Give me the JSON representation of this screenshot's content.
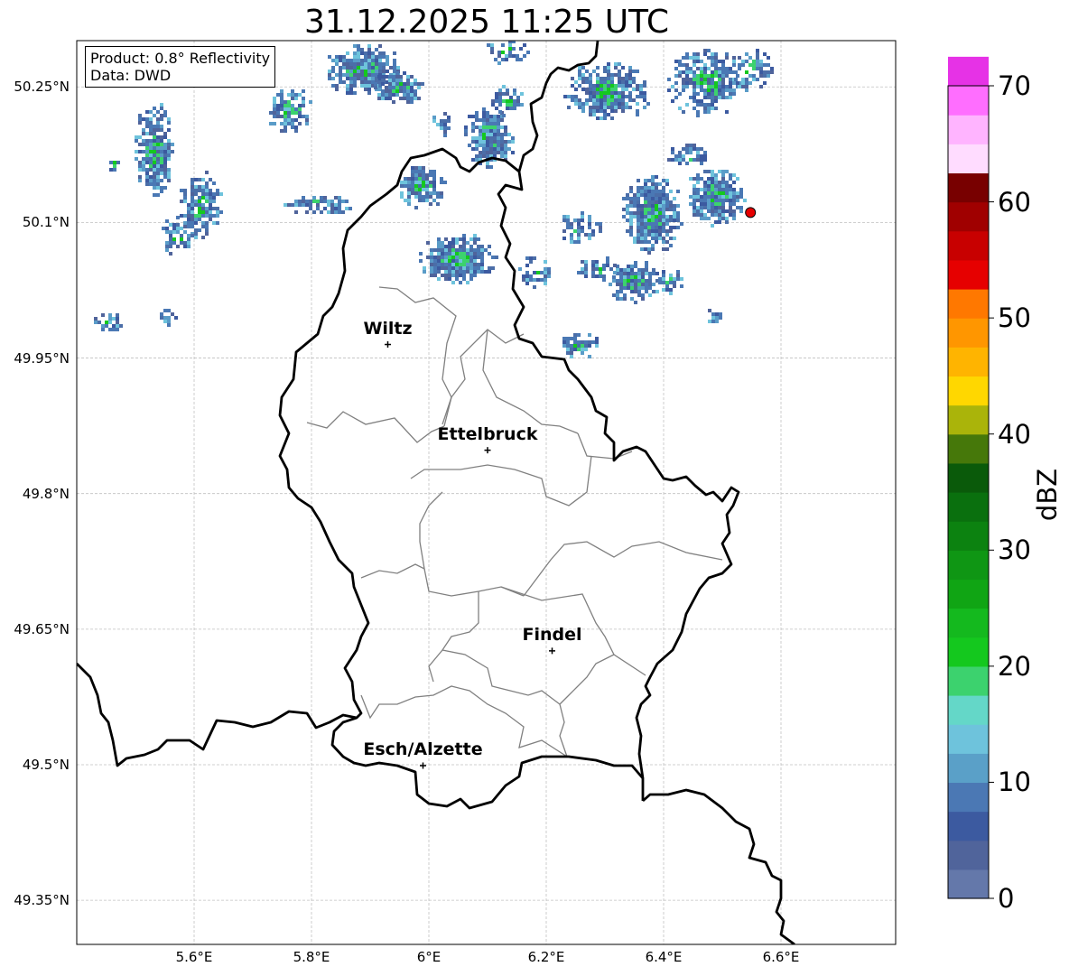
{
  "title": "31.12.2025 11:25 UTC",
  "info": {
    "product": "Product: 0.8° Reflectivity",
    "source": "Data: DWD"
  },
  "lat_labels": [
    "50.25°N",
    "50.1°N",
    "49.95°N",
    "49.8°N",
    "49.65°N",
    "49.5°N",
    "49.35°N"
  ],
  "lon_labels": [
    "5.6°E",
    "5.8°E",
    "6°E",
    "6.2°E",
    "6.4°E",
    "6.6°E"
  ],
  "cities": [
    {
      "name": "Wiltz",
      "lon": 5.93,
      "lat": 49.965
    },
    {
      "name": "Ettelbruck",
      "lon": 6.1,
      "lat": 49.848
    },
    {
      "name": "Findel",
      "lon": 6.21,
      "lat": 49.626
    },
    {
      "name": "Esch/Alzette",
      "lon": 5.99,
      "lat": 49.499
    }
  ],
  "radar_site": {
    "lon": 6.548,
    "lat": 50.111,
    "color": "#e60000"
  },
  "colorbar": {
    "label": "dBZ",
    "ticks": [
      "0",
      "10",
      "20",
      "30",
      "40",
      "50",
      "60",
      "70"
    ],
    "min": 0,
    "max": 70,
    "step": 2.5,
    "colors": [
      "#6478aa",
      "#50649b",
      "#3c5aa0",
      "#4b78b4",
      "#5aa0c8",
      "#6ec3dc",
      "#64d7c8",
      "#3cd26e",
      "#14c81e",
      "#14b91e",
      "#10a514",
      "#0f9614",
      "#0c8210",
      "#0a700e",
      "#0a5a0a",
      "#46780a",
      "#aab40a",
      "#ffd700",
      "#ffb400",
      "#ff9600",
      "#ff7800",
      "#e60000",
      "#c80000",
      "#a00000",
      "#780000",
      "#ffdcff",
      "#ffb4ff",
      "#ff6eff",
      "#e632e6"
    ]
  },
  "map_colors": {
    "border": "#000000",
    "canton": "#808080",
    "grid": "#c0c0c0"
  }
}
